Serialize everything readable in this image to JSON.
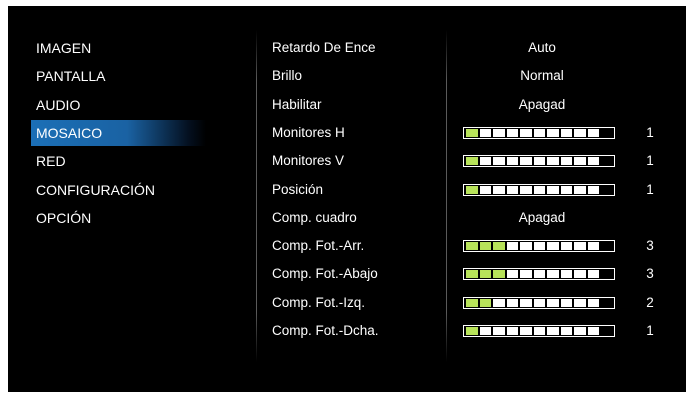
{
  "menu": {
    "items": [
      {
        "label": "IMAGEN",
        "selected": false
      },
      {
        "label": "PANTALLA",
        "selected": false
      },
      {
        "label": "AUDIO",
        "selected": false
      },
      {
        "label": "MOSAICO",
        "selected": true
      },
      {
        "label": "RED",
        "selected": false
      },
      {
        "label": "CONFIGURACIÓN",
        "selected": false
      },
      {
        "label": "OPCIÓN",
        "selected": false
      }
    ]
  },
  "settings": [
    {
      "label": "Retardo De Ence",
      "type": "text",
      "value": "Auto"
    },
    {
      "label": "Brillo",
      "type": "text",
      "value": "Normal"
    },
    {
      "label": "Habilitar",
      "type": "text",
      "value": "Apagad"
    },
    {
      "label": "Monitores H",
      "type": "bar",
      "value": "1",
      "level": 1,
      "max": 10
    },
    {
      "label": "Monitores V",
      "type": "bar",
      "value": "1",
      "level": 1,
      "max": 10
    },
    {
      "label": "Posición",
      "type": "bar",
      "value": "1",
      "level": 1,
      "max": 10
    },
    {
      "label": "Comp. cuadro",
      "type": "text",
      "value": "Apagad"
    },
    {
      "label": "Comp. Fot.-Arr.",
      "type": "bar",
      "value": "3",
      "level": 3,
      "max": 10
    },
    {
      "label": "Comp. Fot.-Abajo",
      "type": "bar",
      "value": "3",
      "level": 3,
      "max": 10
    },
    {
      "label": "Comp. Fot.-Izq.",
      "type": "bar",
      "value": "2",
      "level": 2,
      "max": 10
    },
    {
      "label": "Comp. Fot.-Dcha.",
      "type": "bar",
      "value": "1",
      "level": 1,
      "max": 10
    }
  ],
  "colors": {
    "selection": "#1b6fb6",
    "bar_active": "#b8e35a",
    "bar_inactive": "#ffffff",
    "background": "#000000"
  }
}
